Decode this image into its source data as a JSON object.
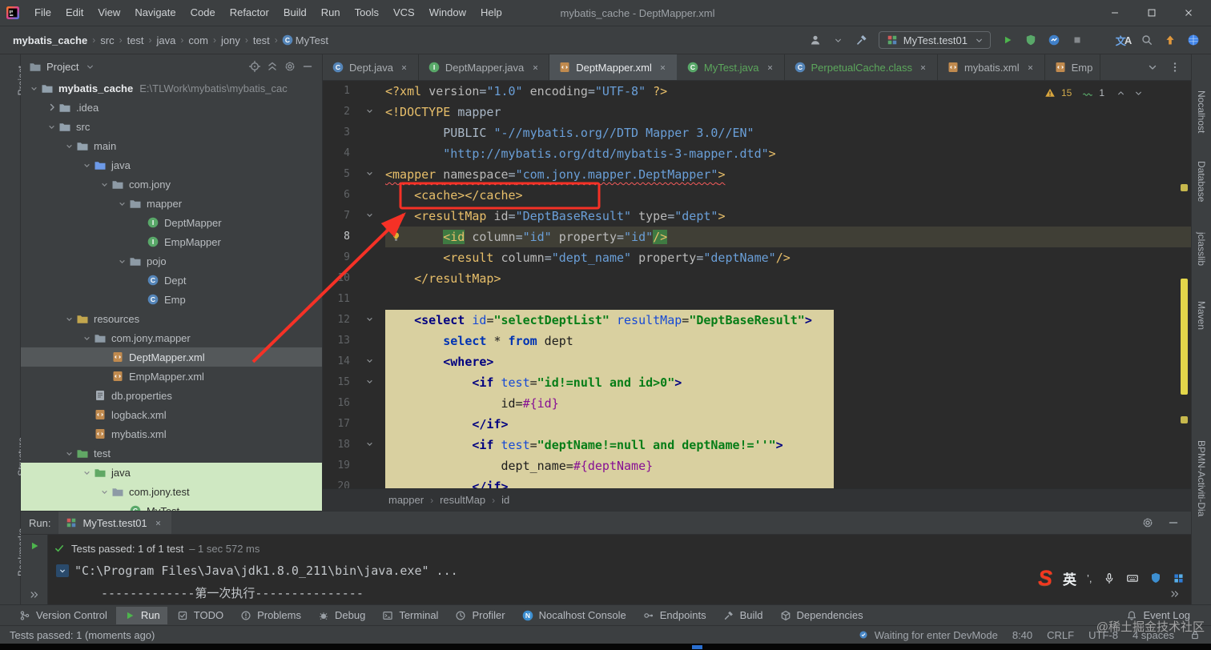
{
  "colors": {
    "annotation_red": "#f53126",
    "accent_green": "#4db54d",
    "coverage_row_bg": "#cfe8c2",
    "injection_bg": "#d9d0a0",
    "selection_gray": "#54585a",
    "warning_yellow": "#d9a63e"
  },
  "window": {
    "title": "mybatis_cache - DeptMapper.xml",
    "menus": [
      "File",
      "Edit",
      "View",
      "Navigate",
      "Code",
      "Refactor",
      "Build",
      "Run",
      "Tools",
      "VCS",
      "Window",
      "Help"
    ]
  },
  "navbar": {
    "path": [
      "mybatis_cache",
      "src",
      "test",
      "java",
      "com",
      "jony",
      "test"
    ],
    "class_crumb": "MyTest",
    "run_config": "MyTest.test01",
    "right_icons": [
      "play",
      "coverage",
      "profiler-run",
      "stop",
      "gap",
      "translate",
      "search",
      "update",
      "blue-ball"
    ]
  },
  "left_stripe": [
    {
      "label": "Project"
    },
    {
      "label": "Structure"
    },
    {
      "label": "Bookmarks"
    }
  ],
  "right_stripe": [
    {
      "label": "Nocalhost"
    },
    {
      "label": "Database"
    },
    {
      "label": "jclasslib"
    },
    {
      "label": "Maven"
    },
    {
      "label": "BPMN-Activiti-Dia"
    }
  ],
  "project": {
    "header": {
      "title": "Project",
      "icons": [
        "locate",
        "collapse-all",
        "settings",
        "hide"
      ]
    },
    "tree": [
      {
        "i": 0,
        "c": "v",
        "icon": "project-folder",
        "label": "mybatis_cache",
        "bold": true,
        "extra": "E:\\TLWork\\mybatis\\mybatis_cac"
      },
      {
        "i": 1,
        "c": ">",
        "icon": "folder",
        "label": ".idea"
      },
      {
        "i": 1,
        "c": "v",
        "icon": "folder",
        "label": "src"
      },
      {
        "i": 2,
        "c": "v",
        "icon": "folder",
        "label": "main"
      },
      {
        "i": 3,
        "c": "v",
        "icon": "src-folder",
        "label": "java"
      },
      {
        "i": 4,
        "c": "v",
        "icon": "package",
        "label": "com.jony"
      },
      {
        "i": 5,
        "c": "v",
        "icon": "package",
        "label": "mapper"
      },
      {
        "i": 6,
        "c": "",
        "icon": "interface",
        "label": "DeptMapper"
      },
      {
        "i": 6,
        "c": "",
        "icon": "interface",
        "label": "EmpMapper"
      },
      {
        "i": 5,
        "c": "v",
        "icon": "package",
        "label": "pojo"
      },
      {
        "i": 6,
        "c": "",
        "icon": "class",
        "label": "Dept"
      },
      {
        "i": 6,
        "c": "",
        "icon": "class",
        "label": "Emp"
      },
      {
        "i": 2,
        "c": "v",
        "icon": "res-folder",
        "label": "resources"
      },
      {
        "i": 3,
        "c": "v",
        "icon": "package",
        "label": "com.jony.mapper"
      },
      {
        "i": 4,
        "c": "",
        "icon": "xml-file",
        "label": "DeptMapper.xml",
        "selected": true
      },
      {
        "i": 4,
        "c": "",
        "icon": "xml-file",
        "label": "EmpMapper.xml"
      },
      {
        "i": 3,
        "c": "",
        "icon": "prop-file",
        "label": "db.properties"
      },
      {
        "i": 3,
        "c": "",
        "icon": "xml-file",
        "label": "logback.xml"
      },
      {
        "i": 3,
        "c": "",
        "icon": "xml-file",
        "label": "mybatis.xml"
      },
      {
        "i": 2,
        "c": "v",
        "icon": "test-folder",
        "label": "test"
      },
      {
        "i": 3,
        "c": "v",
        "icon": "test-folder",
        "label": "java",
        "covered": true
      },
      {
        "i": 4,
        "c": "v",
        "icon": "package",
        "label": "com.jony.test",
        "covered": true
      },
      {
        "i": 5,
        "c": "",
        "icon": "test-class",
        "label": "MyTest",
        "covered": true
      }
    ]
  },
  "editor": {
    "tabs": [
      {
        "icon": "class",
        "label": "Dept.java"
      },
      {
        "icon": "interface",
        "label": "DeptMapper.java"
      },
      {
        "icon": "xml-file",
        "label": "DeptMapper.xml",
        "active": true
      },
      {
        "icon": "test-class",
        "label": "MyTest.java",
        "green": true
      },
      {
        "icon": "class",
        "label": "PerpetualCache.class",
        "green": true
      },
      {
        "icon": "xml-file",
        "label": "mybatis.xml"
      },
      {
        "icon": "xml-file",
        "label": "Emp",
        "truncated": true
      }
    ],
    "inspections": {
      "warnings": "15",
      "typos": "1"
    },
    "breadcrumbs": [
      "mapper",
      "resultMap",
      "id"
    ],
    "lines": [
      {
        "n": "1",
        "seg": [
          [
            "t",
            "<?xml "
          ],
          [
            "a",
            "version"
          ],
          [
            "p",
            "="
          ],
          [
            "v",
            "\"1.0\""
          ],
          [
            "p",
            " "
          ],
          [
            "a",
            "encoding"
          ],
          [
            "p",
            "="
          ],
          [
            "v",
            "\"UTF-8\""
          ],
          [
            "t",
            " ?>"
          ]
        ]
      },
      {
        "n": "2",
        "fold": 1,
        "seg": [
          [
            "t",
            "<!DOCTYPE "
          ],
          [
            "p",
            "mapper"
          ]
        ]
      },
      {
        "n": "3",
        "seg": [
          [
            "p",
            "        PUBLIC "
          ],
          [
            "v",
            "\"-//mybatis.org//DTD Mapper 3.0//EN\""
          ]
        ]
      },
      {
        "n": "4",
        "seg": [
          [
            "p",
            "        "
          ],
          [
            "v",
            "\"http://mybatis.org/dtd/mybatis-3-mapper.dtd\""
          ],
          [
            "t",
            ">"
          ]
        ]
      },
      {
        "n": "5",
        "fold": 1,
        "err": 1,
        "seg": [
          [
            "t",
            "<mapper "
          ],
          [
            "a",
            "namespace"
          ],
          [
            "p",
            "="
          ],
          [
            "v",
            "\"com.jony.mapper.DeptMapper\""
          ],
          [
            "t",
            ">"
          ]
        ]
      },
      {
        "n": "6",
        "seg": [
          [
            "p",
            "    "
          ],
          [
            "t",
            "<cache></cache>"
          ]
        ]
      },
      {
        "n": "7",
        "fold": 1,
        "seg": [
          [
            "p",
            "    "
          ],
          [
            "t",
            "<resultMap "
          ],
          [
            "a",
            "id"
          ],
          [
            "p",
            "="
          ],
          [
            "v",
            "\"DeptBaseResult\""
          ],
          [
            "p",
            " "
          ],
          [
            "a",
            "type"
          ],
          [
            "p",
            "="
          ],
          [
            "v",
            "\"dept\""
          ],
          [
            "t",
            ">"
          ]
        ]
      },
      {
        "n": "8",
        "cur": 1,
        "bulb": 1,
        "seg": [
          [
            "p",
            "        "
          ],
          [
            "t tm",
            "<id"
          ],
          [
            "p",
            " "
          ],
          [
            "a",
            "column"
          ],
          [
            "p",
            "="
          ],
          [
            "v",
            "\"id\""
          ],
          [
            "p",
            " "
          ],
          [
            "a",
            "property"
          ],
          [
            "p",
            "="
          ],
          [
            "v",
            "\"id\""
          ],
          [
            "t tm",
            "/>"
          ]
        ]
      },
      {
        "n": "9",
        "seg": [
          [
            "p",
            "        "
          ],
          [
            "t",
            "<result "
          ],
          [
            "a",
            "column"
          ],
          [
            "p",
            "="
          ],
          [
            "v",
            "\"dept_name\""
          ],
          [
            "p",
            " "
          ],
          [
            "a",
            "property"
          ],
          [
            "p",
            "="
          ],
          [
            "v",
            "\"deptName\""
          ],
          [
            "t",
            "/>"
          ]
        ]
      },
      {
        "n": "10",
        "seg": [
          [
            "p",
            "    "
          ],
          [
            "t",
            "</resultMap>"
          ]
        ]
      },
      {
        "n": "11",
        "seg": []
      },
      {
        "n": "12",
        "fold": 1,
        "blk": 1,
        "seg": [
          [
            "P",
            "    "
          ],
          [
            "T",
            "<select "
          ],
          [
            "A",
            "id"
          ],
          [
            "P",
            "="
          ],
          [
            "V",
            "\"selectDeptList\""
          ],
          [
            "P",
            " "
          ],
          [
            "A",
            "resultMap"
          ],
          [
            "P",
            "="
          ],
          [
            "V",
            "\"DeptBaseResult\""
          ],
          [
            "T",
            ">"
          ]
        ]
      },
      {
        "n": "13",
        "blk": 1,
        "seg": [
          [
            "P",
            "        "
          ],
          [
            "K",
            "select"
          ],
          [
            "P",
            " * "
          ],
          [
            "K",
            "from"
          ],
          [
            "P",
            " dept"
          ]
        ]
      },
      {
        "n": "14",
        "fold": 1,
        "blk": 1,
        "seg": [
          [
            "P",
            "        "
          ],
          [
            "T",
            "<where>"
          ]
        ]
      },
      {
        "n": "15",
        "fold": 1,
        "blk": 1,
        "seg": [
          [
            "P",
            "            "
          ],
          [
            "T",
            "<if "
          ],
          [
            "A",
            "test"
          ],
          [
            "P",
            "="
          ],
          [
            "V",
            "\"id!=null and id>0\""
          ],
          [
            "T",
            ">"
          ]
        ]
      },
      {
        "n": "16",
        "blk": 1,
        "seg": [
          [
            "P",
            "                id="
          ],
          [
            "M",
            "#{id}"
          ]
        ]
      },
      {
        "n": "17",
        "blk": 1,
        "seg": [
          [
            "P",
            "            "
          ],
          [
            "T",
            "</if>"
          ]
        ]
      },
      {
        "n": "18",
        "fold": 1,
        "blk": 1,
        "seg": [
          [
            "P",
            "            "
          ],
          [
            "T",
            "<if "
          ],
          [
            "A",
            "test"
          ],
          [
            "P",
            "="
          ],
          [
            "V",
            "\"deptName!=null and deptName!=''\""
          ],
          [
            "T",
            ">"
          ]
        ]
      },
      {
        "n": "19",
        "blk": 1,
        "seg": [
          [
            "P",
            "                dept_name="
          ],
          [
            "M",
            "#{deptName}"
          ]
        ]
      },
      {
        "n": "20",
        "blk": 1,
        "seg": [
          [
            "P",
            "            "
          ],
          [
            "T",
            "</if>"
          ]
        ]
      }
    ]
  },
  "run": {
    "label": "Run:",
    "tab": "MyTest.test01",
    "header_icons": [
      "settings",
      "hide"
    ],
    "toolbar_icons": [
      "play",
      "expand-right"
    ],
    "result": {
      "main": "Tests passed: 1 of 1 test",
      "dim": "– 1 sec 572 ms"
    },
    "console": [
      {
        "chev": true,
        "mono": "\"C:\\Program Files\\Java\\jdk1.8.0_211\\bin\\java.exe\" ..."
      },
      {
        "mono": "-------------第一次执行---------------"
      }
    ]
  },
  "bottom_bar": {
    "items": [
      {
        "icon": "branch",
        "label": "Version Control"
      },
      {
        "icon": "play",
        "label": "Run",
        "selected": true
      },
      {
        "icon": "todo",
        "label": "TODO"
      },
      {
        "icon": "problems",
        "label": "Problems"
      },
      {
        "icon": "debug",
        "label": "Debug"
      },
      {
        "icon": "terminal",
        "label": "Terminal"
      },
      {
        "icon": "profiler",
        "label": "Profiler"
      },
      {
        "icon": "nocalhost",
        "label": "Nocalhost Console"
      },
      {
        "icon": "endpoints",
        "label": "Endpoints"
      },
      {
        "icon": "build",
        "label": "Build"
      },
      {
        "icon": "dependencies",
        "label": "Dependencies"
      }
    ],
    "right": {
      "icon": "event-log",
      "label": "Event Log"
    }
  },
  "status": {
    "left": "Tests passed: 1 (moments ago)",
    "right": [
      {
        "icon": "devmode",
        "label": "Waiting for enter DevMode"
      },
      {
        "label": "8:40"
      },
      {
        "label": "CRLF"
      },
      {
        "label": "UTF-8"
      },
      {
        "label": "4 spaces"
      },
      {
        "icon": "lock",
        "label": ""
      }
    ]
  },
  "ime": {
    "logo": "S",
    "mode": "英",
    "punct": "’,"
  },
  "watermark": "@稀土掘金技术社区"
}
